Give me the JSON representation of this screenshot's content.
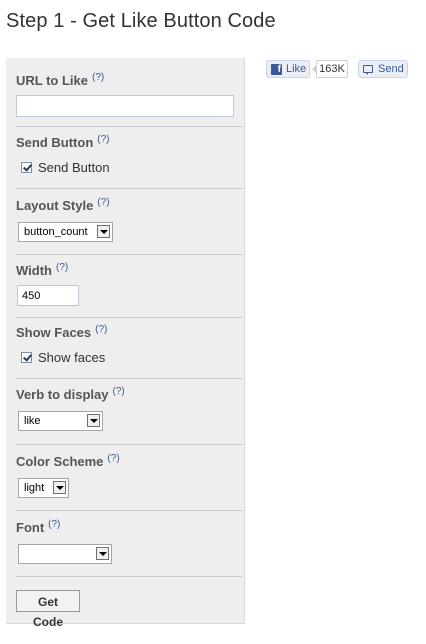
{
  "page_title": "Step 1 - Get Like Button Code",
  "help_marker": "(?)",
  "form": {
    "url": {
      "label": "URL to Like",
      "value": ""
    },
    "send_button": {
      "label": "Send Button",
      "checkbox_label": "Send Button",
      "checked": true
    },
    "layout_style": {
      "label": "Layout Style",
      "selected": "button_count"
    },
    "width": {
      "label": "Width",
      "value": "450"
    },
    "show_faces": {
      "label": "Show Faces",
      "checkbox_label": "Show faces",
      "checked": true
    },
    "verb": {
      "label": "Verb to display",
      "selected": "like"
    },
    "color_scheme": {
      "label": "Color Scheme",
      "selected": "light"
    },
    "font": {
      "label": "Font",
      "selected": ""
    },
    "submit_label": "Get Code"
  },
  "preview": {
    "like_label": "Like",
    "like_count": "163K",
    "send_label": "Send",
    "fb_icon": "facebook-f-icon",
    "send_icon": "speech-bubble-icon"
  },
  "colors": {
    "facebook_blue": "#3b5998",
    "panel_bg": "#eeeeee",
    "button_bg": "#eceef5"
  }
}
